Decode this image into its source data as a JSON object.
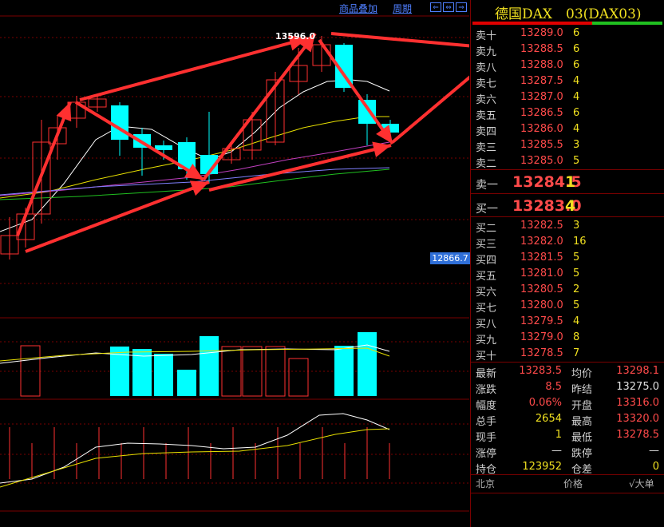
{
  "toolbar": {
    "overlay_label": "商品叠加",
    "period_label": "周期",
    "nav_buttons": [
      "⇐",
      "⇔",
      "⇒"
    ]
  },
  "chart": {
    "peak_label": "13596.0",
    "price_tag": "12866.7",
    "colors": {
      "up": "#ff3030",
      "down": "#00ffff",
      "grid": "#7a0000",
      "ma1": "#ffffff",
      "ma2": "#e8e000",
      "ma3": "#c040c0",
      "ma4": "#20c020",
      "ma5": "#8080ff",
      "arrow": "#ff3030"
    }
  },
  "panel": {
    "title": "德国DAX　03(DAX03)",
    "asks": [
      {
        "label": "卖十",
        "price": "13289.0",
        "qty": "6"
      },
      {
        "label": "卖九",
        "price": "13288.5",
        "qty": "6"
      },
      {
        "label": "卖八",
        "price": "13288.0",
        "qty": "6"
      },
      {
        "label": "卖七",
        "price": "13287.5",
        "qty": "4"
      },
      {
        "label": "卖六",
        "price": "13287.0",
        "qty": "4"
      },
      {
        "label": "卖五",
        "price": "13286.5",
        "qty": "6"
      },
      {
        "label": "卖四",
        "price": "13286.0",
        "qty": "4"
      },
      {
        "label": "卖三",
        "price": "13285.5",
        "qty": "3"
      },
      {
        "label": "卖二",
        "price": "13285.0",
        "qty": "5"
      }
    ],
    "ask1": {
      "label": "卖一",
      "price": "13284.5",
      "qty": "1"
    },
    "bid1": {
      "label": "买一",
      "price": "13283.0",
      "qty": "4"
    },
    "bids": [
      {
        "label": "买二",
        "price": "13282.5",
        "qty": "3"
      },
      {
        "label": "买三",
        "price": "13282.0",
        "qty": "16"
      },
      {
        "label": "买四",
        "price": "13281.5",
        "qty": "5"
      },
      {
        "label": "买五",
        "price": "13281.0",
        "qty": "5"
      },
      {
        "label": "买六",
        "price": "13280.5",
        "qty": "2"
      },
      {
        "label": "买七",
        "price": "13280.0",
        "qty": "5"
      },
      {
        "label": "买八",
        "price": "13279.5",
        "qty": "4"
      },
      {
        "label": "买九",
        "price": "13279.0",
        "qty": "8"
      },
      {
        "label": "买十",
        "price": "13278.5",
        "qty": "7"
      }
    ],
    "stats_left": [
      {
        "k": "最新",
        "v": "13283.5",
        "c": "red"
      },
      {
        "k": "涨跌",
        "v": "8.5",
        "c": "red"
      },
      {
        "k": "幅度",
        "v": "0.06%",
        "c": "red"
      },
      {
        "k": "总手",
        "v": "2654",
        "c": "yel"
      },
      {
        "k": "现手",
        "v": "1",
        "c": "yel"
      },
      {
        "k": "涨停",
        "v": "—",
        "c": "wht"
      },
      {
        "k": "持仓",
        "v": "123952",
        "c": "yel"
      }
    ],
    "stats_right": [
      {
        "k": "均价",
        "v": "13298.1",
        "c": "red"
      },
      {
        "k": "昨结",
        "v": "13275.0",
        "c": "wht"
      },
      {
        "k": "开盘",
        "v": "13316.0",
        "c": "red"
      },
      {
        "k": "最高",
        "v": "13320.0",
        "c": "red"
      },
      {
        "k": "最低",
        "v": "13278.5",
        "c": "red"
      },
      {
        "k": "跌停",
        "v": "—",
        "c": "wht"
      },
      {
        "k": "仓差",
        "v": "0",
        "c": "yel"
      }
    ],
    "footer": {
      "col1": "北京",
      "col2": "价格",
      "col3": "√大单"
    }
  }
}
